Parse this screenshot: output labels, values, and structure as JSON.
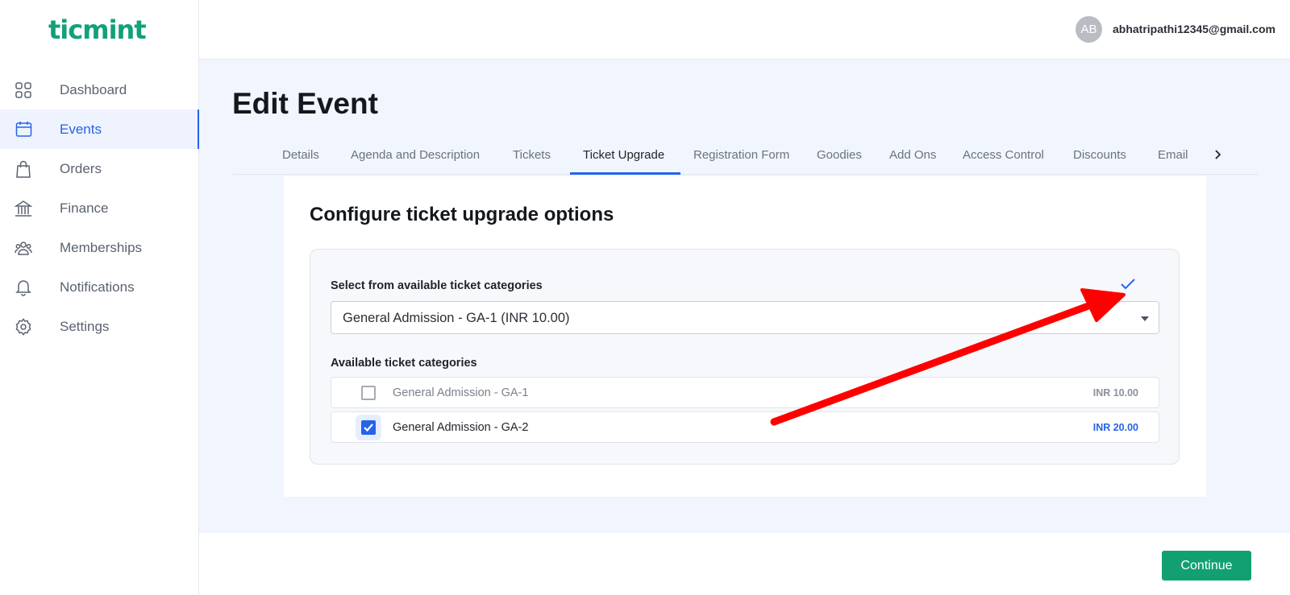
{
  "app": {
    "logo_text": "ticmint",
    "brand_color": "#13a07a",
    "accent_color": "#2563eb"
  },
  "sidebar": {
    "items": [
      {
        "label": "Dashboard",
        "icon": "grid-icon",
        "active": false
      },
      {
        "label": "Events",
        "icon": "calendar-icon",
        "active": true
      },
      {
        "label": "Orders",
        "icon": "shopping-bag-icon",
        "active": false
      },
      {
        "label": "Finance",
        "icon": "bank-icon",
        "active": false
      },
      {
        "label": "Memberships",
        "icon": "users-icon",
        "active": false
      },
      {
        "label": "Notifications",
        "icon": "bell-icon",
        "active": false
      },
      {
        "label": "Settings",
        "icon": "gear-icon",
        "active": false
      }
    ]
  },
  "header": {
    "avatar_initials": "AB",
    "user_email": "abhatripathi12345@gmail.com"
  },
  "page": {
    "title": "Edit Event"
  },
  "tabs": [
    {
      "label": "Details"
    },
    {
      "label": "Agenda and Description"
    },
    {
      "label": "Tickets"
    },
    {
      "label": "Ticket Upgrade",
      "active": true
    },
    {
      "label": "Registration Form"
    },
    {
      "label": "Goodies"
    },
    {
      "label": "Add Ons"
    },
    {
      "label": "Access Control"
    },
    {
      "label": "Discounts"
    },
    {
      "label": "Email"
    }
  ],
  "upgrade": {
    "heading": "Configure ticket upgrade options",
    "select_label": "Select from available ticket categories",
    "select_value": "General Admission - GA-1 (INR 10.00)",
    "available_label": "Available ticket categories",
    "categories": [
      {
        "name": "General Admission - GA-1",
        "price": "INR 10.00",
        "checked": false
      },
      {
        "name": "General Admission - GA-2",
        "price": "INR 20.00",
        "checked": true
      }
    ]
  },
  "footer": {
    "continue_label": "Continue",
    "continue_color": "#12a073"
  },
  "annotation": {
    "arrow_color": "#ff0000"
  }
}
